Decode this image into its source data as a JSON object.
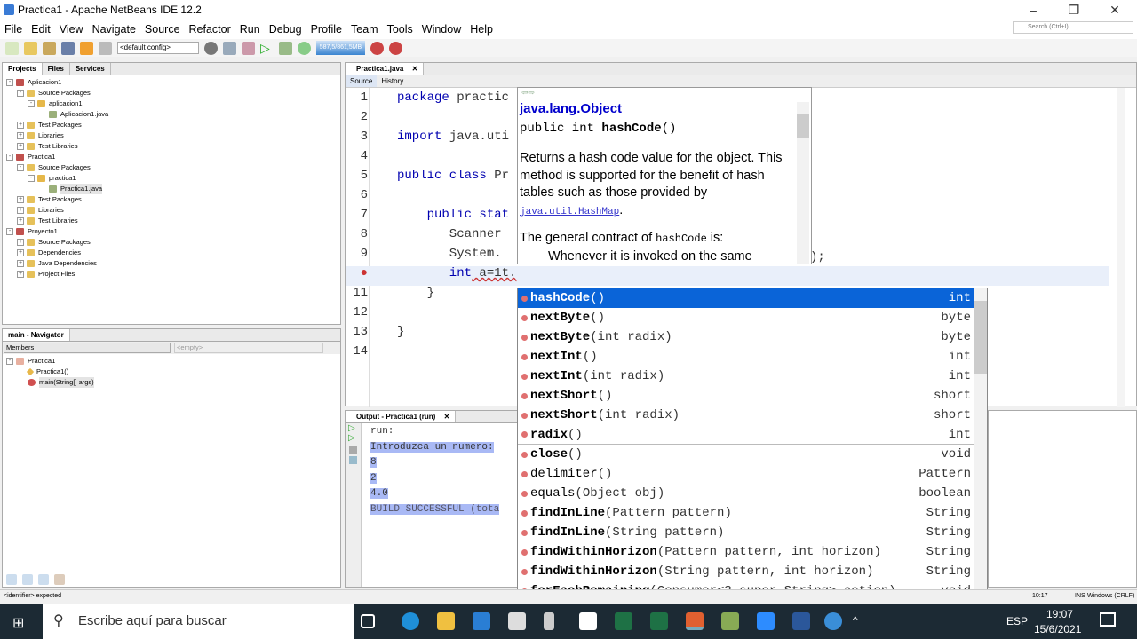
{
  "window": {
    "title": "Practica1 - Apache NetBeans IDE 12.2"
  },
  "menu": [
    "File",
    "Edit",
    "View",
    "Navigate",
    "Source",
    "Refactor",
    "Run",
    "Debug",
    "Profile",
    "Team",
    "Tools",
    "Window",
    "Help"
  ],
  "toolbar": {
    "config": "<default config>",
    "memory": "587,5/861,5MB",
    "search_placeholder": "Search (Ctrl+I)"
  },
  "projects": {
    "tabs": [
      "Projects",
      "Files",
      "Services"
    ],
    "tree": [
      {
        "label": "Aplicacion1",
        "level": 0,
        "sign": "-",
        "color": "#c0504d"
      },
      {
        "label": "Source Packages",
        "level": 1,
        "sign": "-",
        "color": "#e6c15a"
      },
      {
        "label": "aplicacion1",
        "level": 2,
        "sign": "-",
        "color": "#e6b84a"
      },
      {
        "label": "Aplicacion1.java",
        "level": 3,
        "sign": "",
        "color": "#9bb07a"
      },
      {
        "label": "Test Packages",
        "level": 1,
        "sign": "+",
        "color": "#e6c15a"
      },
      {
        "label": "Libraries",
        "level": 1,
        "sign": "+",
        "color": "#e6c15a"
      },
      {
        "label": "Test Libraries",
        "level": 1,
        "sign": "+",
        "color": "#e6c15a"
      },
      {
        "label": "Practica1",
        "level": 0,
        "sign": "-",
        "color": "#c0504d"
      },
      {
        "label": "Source Packages",
        "level": 1,
        "sign": "-",
        "color": "#e6c15a"
      },
      {
        "label": "practica1",
        "level": 2,
        "sign": "-",
        "color": "#e6b84a"
      },
      {
        "label": "Practica1.java",
        "level": 3,
        "sign": "",
        "color": "#9bb07a"
      },
      {
        "label": "Test Packages",
        "level": 1,
        "sign": "+",
        "color": "#e6c15a"
      },
      {
        "label": "Libraries",
        "level": 1,
        "sign": "+",
        "color": "#e6c15a"
      },
      {
        "label": "Test Libraries",
        "level": 1,
        "sign": "+",
        "color": "#e6c15a"
      },
      {
        "label": "Proyecto1",
        "level": 0,
        "sign": "-",
        "color": "#c0504d"
      },
      {
        "label": "Source Packages",
        "level": 1,
        "sign": "+",
        "color": "#e6c15a"
      },
      {
        "label": "Dependencies",
        "level": 1,
        "sign": "+",
        "color": "#e6c15a"
      },
      {
        "label": "Java Dependencies",
        "level": 1,
        "sign": "+",
        "color": "#e6c15a"
      },
      {
        "label": "Project Files",
        "level": 1,
        "sign": "+",
        "color": "#e6c15a"
      }
    ]
  },
  "navigator": {
    "title": "main - Navigator",
    "filter": "Members",
    "empty": "<empty>",
    "tree": [
      "Practica1",
      "Practica1()",
      "main(String[] args)"
    ]
  },
  "editor": {
    "tab": "Practica1.java",
    "source": "Source",
    "history": "History",
    "line_numbers": [
      "1",
      "2",
      "3",
      "4",
      "5",
      "6",
      "7",
      "8",
      "9",
      "",
      "11",
      "12",
      "13",
      "14"
    ],
    "lines": [
      {
        "kw": "package",
        "rest": " practic"
      },
      {
        "kw": "",
        "rest": ""
      },
      {
        "kw": "import",
        "rest": " java.uti"
      },
      {
        "kw": "",
        "rest": ""
      },
      {
        "kw": "public class",
        "rest": " Pr"
      },
      {
        "kw": "",
        "rest": ""
      },
      {
        "kw": "    public stat",
        "rest": ""
      },
      {
        "kw": "",
        "rest": "       Scanner"
      },
      {
        "kw": "",
        "rest": "       System."
      },
      {
        "kw": "       int",
        "rest": " a=1t."
      },
      {
        "kw": "",
        "rest": "    }"
      },
      {
        "kw": "",
        "rest": ""
      },
      {
        "kw": "",
        "rest": "}"
      },
      {
        "kw": "",
        "rest": ""
      }
    ],
    "line9_tail": ");"
  },
  "javadoc": {
    "class_link": "java.lang.Object",
    "signature_prefix": "public int ",
    "signature_name": "hashCode",
    "signature_suffix": "()",
    "p1": "Returns a hash code value for the object. This method is supported for the benefit of hash tables such as those provided by ",
    "p1_link": "java.util.HashMap",
    "p1_end": ".",
    "p2_a": "The general contract of ",
    "p2_code": "hashCode",
    "p2_b": " is:",
    "p3": "Whenever it is invoked on the same"
  },
  "completion": [
    {
      "name": "hashCode",
      "params": "()",
      "type": "int"
    },
    {
      "name": "nextByte",
      "params": "()",
      "type": "byte"
    },
    {
      "name": "nextByte",
      "params": "(int radix)",
      "type": "byte"
    },
    {
      "name": "nextInt",
      "params": "()",
      "type": "int"
    },
    {
      "name": "nextInt",
      "params": "(int radix)",
      "type": "int"
    },
    {
      "name": "nextShort",
      "params": "()",
      "type": "short"
    },
    {
      "name": "nextShort",
      "params": "(int radix)",
      "type": "short"
    },
    {
      "name": "radix",
      "params": "()",
      "type": "int"
    },
    {
      "name": "close",
      "params": "()",
      "type": "void"
    },
    {
      "name": "delimiter",
      "params": "()",
      "type": "Pattern"
    },
    {
      "name": "equals",
      "params": "(Object obj)",
      "type": "boolean"
    },
    {
      "name": "findInLine",
      "params": "(Pattern pattern)",
      "type": "String"
    },
    {
      "name": "findInLine",
      "params": "(String pattern)",
      "type": "String"
    },
    {
      "name": "findWithinHorizon",
      "params": "(Pattern pattern, int horizon)",
      "type": "String"
    },
    {
      "name": "findWithinHorizon",
      "params": "(String pattern, int horizon)",
      "type": "String"
    },
    {
      "name": "forEachRemaining",
      "params": "(Consumer<? super String> action)",
      "type": "void"
    }
  ],
  "output": {
    "tab": "Output - Practica1 (run)",
    "lines": [
      "run:",
      "Introduzca un numero:",
      "8",
      "2",
      "4.0",
      "BUILD SUCCESSFUL (tota"
    ]
  },
  "status": {
    "message": "<identifier> expected",
    "position": "10:17",
    "mode": "INS",
    "line_ending": "Windows (CRLF)"
  },
  "taskbar": {
    "search": "Escribe aquí para buscar",
    "lang": "ESP",
    "time": "19:07",
    "date": "15/6/2021"
  }
}
